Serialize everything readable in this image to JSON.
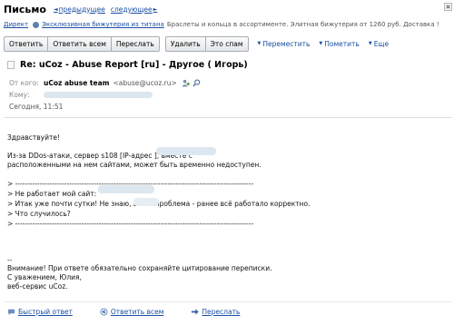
{
  "header": {
    "title": "Письмо",
    "prev_label": "предыдущее",
    "next_label": "следующее"
  },
  "ad": {
    "label": "Директ",
    "link": "Эксклюзивная бижутерия из титана",
    "text": "Браслеты и кольца в ассортименте. Элитная бижутерия от 1260 руб. Доставка !"
  },
  "toolbar": {
    "reply": "Ответить",
    "reply_all": "Ответить всем",
    "forward": "Переслать",
    "delete": "Удалить",
    "spam": "Это спам",
    "move": "Переместить",
    "mark": "Пометить",
    "more": "Еще"
  },
  "message": {
    "subject": "Re: uCoz - Abuse Report [ru] - Другое ( Игорь)",
    "from_label": "От кого:",
    "from_name": "uCoz abuse team",
    "from_email": "<abuse@ucoz.ru>",
    "to_label": "Кому:",
    "date_label": "Сегодня, 11:51"
  },
  "body": {
    "greeting": "Здравствуйте!",
    "line1": "Из-за DDos-атаки, сервер s108 [IP-адрес                        ], вместе с",
    "line2": "расположенными на нем сайтами, может быть временно недоступен.",
    "quote_sep1": "> -------------------------------------------------------------------------------------------------",
    "quote1": "> Не работает мой сайт:",
    "quote2": ">  Итак уже почти сутки! Не знаю, в чем проблема - ранее всё работало корректно.",
    "quote3": ">  Что случилось?",
    "quote_sep2": "> -------------------------------------------------------------------------------------------------",
    "dashes": "--",
    "warning": "Внимание! При ответе обязательно сохраняйте цитирование переписки.",
    "regards": "С уважением, Юлия,",
    "service": "веб-сервис uCoz."
  },
  "bottom": {
    "quick_reply": "Быстрый ответ",
    "reply_all": "Ответить всем",
    "forward": "Переслать"
  },
  "colors": {
    "link": "#1a4fa3",
    "meta_text": "#888888"
  }
}
